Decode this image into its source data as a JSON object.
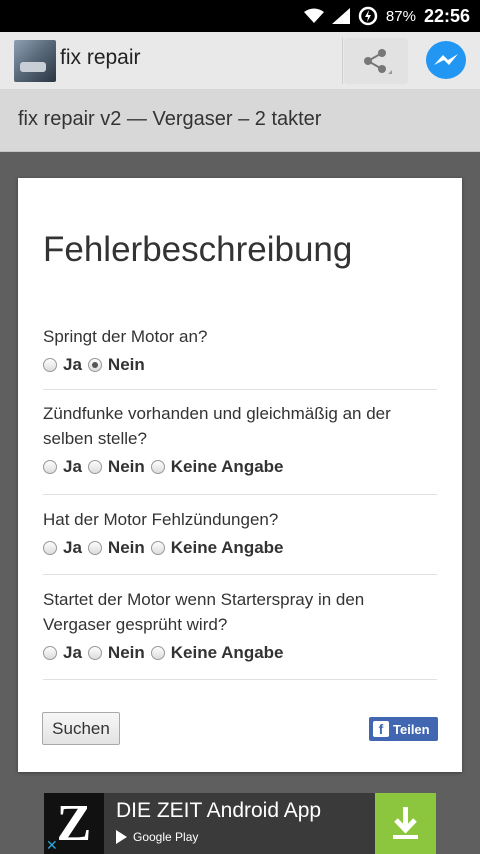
{
  "status_bar": {
    "battery": "87%",
    "time": "22:56",
    "icons": [
      "wifi-icon",
      "signal-icon",
      "data-saver-icon"
    ]
  },
  "app_bar": {
    "title": "fix repair",
    "icons": [
      "app-logo-icon",
      "share-icon",
      "messenger-icon"
    ]
  },
  "subtitle": "fix repair v2 — Vergaser – 2 takter",
  "form": {
    "heading": "Fehlerbeschreibung",
    "questions": [
      {
        "text": "Springt der Motor an?",
        "options": [
          "Ja",
          "Nein"
        ],
        "selected": "Nein"
      },
      {
        "text": "Zündfunke vorhanden und gleichmäßig an der selben stelle?",
        "options": [
          "Ja",
          "Nein",
          "Keine Angabe"
        ],
        "selected": null
      },
      {
        "text": "Hat der Motor Fehlzündungen?",
        "options": [
          "Ja",
          "Nein",
          "Keine Angabe"
        ],
        "selected": null
      },
      {
        "text": "Startet der Motor wenn Starterspray in den Vergaser gesprüht wird?",
        "options": [
          "Ja",
          "Nein",
          "Keine Angabe"
        ],
        "selected": null
      }
    ],
    "search_button": "Suchen",
    "share_button": "Teilen",
    "share_icon_letter": "f"
  },
  "ad": {
    "logo_letter": "Z",
    "title": "DIE ZEIT Android App",
    "store": "Google Play",
    "close": "✕"
  },
  "colors": {
    "facebook": "#4267b2",
    "messenger": "#2196f3",
    "download": "#8cc63f"
  }
}
